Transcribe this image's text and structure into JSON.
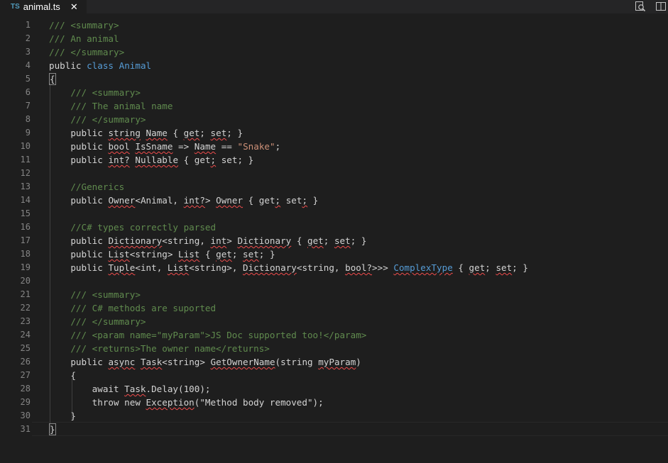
{
  "tab": {
    "lang_badge": "TS",
    "filename": "animal.ts",
    "close_glyph": "✕"
  },
  "toolbar": {
    "icons": [
      "open-changes-icon",
      "split-editor-icon"
    ]
  },
  "colors": {
    "background": "#1e1e1e",
    "comment": "#608b4e",
    "keyword": "#569cd6",
    "string": "#ce9178",
    "line_number": "#858585",
    "squiggle": "#f14c4c"
  },
  "lines": [
    {
      "n": "1",
      "tokens": [
        {
          "t": "/// <summary>",
          "c": "comment"
        }
      ]
    },
    {
      "n": "2",
      "tokens": [
        {
          "t": "/// An animal",
          "c": "comment"
        }
      ]
    },
    {
      "n": "3",
      "tokens": [
        {
          "t": "/// </summary>",
          "c": "comment"
        }
      ]
    },
    {
      "n": "4",
      "tokens": [
        {
          "t": "public",
          "c": "plain"
        },
        {
          "t": " "
        },
        {
          "t": "class",
          "c": "keyword"
        },
        {
          "t": " "
        },
        {
          "t": "Animal",
          "c": "keyword"
        }
      ]
    },
    {
      "n": "5",
      "tokens": [
        {
          "t": "{",
          "c": "bracket",
          "box": true
        }
      ]
    },
    {
      "n": "6",
      "tokens": [
        {
          "t": "    "
        },
        {
          "t": "/// <summary>",
          "c": "comment"
        }
      ]
    },
    {
      "n": "7",
      "tokens": [
        {
          "t": "    "
        },
        {
          "t": "/// The animal name",
          "c": "comment"
        }
      ]
    },
    {
      "n": "8",
      "tokens": [
        {
          "t": "    "
        },
        {
          "t": "/// </summary>",
          "c": "comment"
        }
      ]
    },
    {
      "n": "9",
      "tokens": [
        {
          "t": "    "
        },
        {
          "t": "public",
          "c": "plain"
        },
        {
          "t": " "
        },
        {
          "t": "string",
          "c": "plain",
          "sq": true
        },
        {
          "t": " "
        },
        {
          "t": "Name",
          "c": "plain",
          "sq": true
        },
        {
          "t": " { "
        },
        {
          "t": "get",
          "c": "plain",
          "sq": true
        },
        {
          "t": "; "
        },
        {
          "t": "set",
          "c": "plain",
          "sq": true
        },
        {
          "t": "; }"
        }
      ]
    },
    {
      "n": "10",
      "tokens": [
        {
          "t": "    "
        },
        {
          "t": "public",
          "c": "plain"
        },
        {
          "t": " "
        },
        {
          "t": "bool",
          "c": "plain",
          "sq": true
        },
        {
          "t": " "
        },
        {
          "t": "IsSname",
          "c": "plain",
          "sq": true
        },
        {
          "t": " => "
        },
        {
          "t": "Name",
          "c": "plain",
          "sq": true
        },
        {
          "t": " == "
        },
        {
          "t": "\"Snake\"",
          "c": "string"
        },
        {
          "t": ";"
        }
      ]
    },
    {
      "n": "11",
      "tokens": [
        {
          "t": "    "
        },
        {
          "t": "public",
          "c": "plain"
        },
        {
          "t": " "
        },
        {
          "t": "int?",
          "c": "plain",
          "sq": true
        },
        {
          "t": " "
        },
        {
          "t": "Nullable",
          "c": "plain",
          "sq": true
        },
        {
          "t": " { get"
        },
        {
          "t": ";",
          "c": "plain",
          "sq": true
        },
        {
          "t": " set; }"
        }
      ]
    },
    {
      "n": "12",
      "tokens": []
    },
    {
      "n": "13",
      "tokens": [
        {
          "t": "    "
        },
        {
          "t": "//Generics",
          "c": "comment"
        }
      ]
    },
    {
      "n": "14",
      "tokens": [
        {
          "t": "    "
        },
        {
          "t": "public",
          "c": "plain"
        },
        {
          "t": " "
        },
        {
          "t": "Owner",
          "c": "plain",
          "sq": true
        },
        {
          "t": "<Animal, "
        },
        {
          "t": "int?",
          "c": "plain",
          "sq": true
        },
        {
          "t": "> "
        },
        {
          "t": "Owner",
          "c": "plain",
          "sq": true
        },
        {
          "t": " { get"
        },
        {
          "t": ";",
          "c": "plain",
          "sq": true
        },
        {
          "t": " set"
        },
        {
          "t": ";",
          "c": "plain",
          "sq": true
        },
        {
          "t": " }"
        }
      ]
    },
    {
      "n": "15",
      "tokens": []
    },
    {
      "n": "16",
      "tokens": [
        {
          "t": "    "
        },
        {
          "t": "//C# types correctly parsed",
          "c": "comment"
        }
      ]
    },
    {
      "n": "17",
      "tokens": [
        {
          "t": "    "
        },
        {
          "t": "public",
          "c": "plain"
        },
        {
          "t": " "
        },
        {
          "t": "Dictionary",
          "c": "plain",
          "sq": true
        },
        {
          "t": "<string, "
        },
        {
          "t": "int",
          "c": "plain",
          "sq": true
        },
        {
          "t": "> "
        },
        {
          "t": "Dictionary",
          "c": "plain",
          "sq": true
        },
        {
          "t": " { "
        },
        {
          "t": "get",
          "c": "plain",
          "sq": true
        },
        {
          "t": "; "
        },
        {
          "t": "set",
          "c": "plain",
          "sq": true
        },
        {
          "t": "; }"
        }
      ]
    },
    {
      "n": "18",
      "tokens": [
        {
          "t": "    "
        },
        {
          "t": "public",
          "c": "plain"
        },
        {
          "t": " "
        },
        {
          "t": "List",
          "c": "plain",
          "sq": true
        },
        {
          "t": "<string> "
        },
        {
          "t": "List",
          "c": "plain",
          "sq": true
        },
        {
          "t": " { "
        },
        {
          "t": "get",
          "c": "plain",
          "sq": true
        },
        {
          "t": "; "
        },
        {
          "t": "set",
          "c": "plain",
          "sq": true
        },
        {
          "t": "; }"
        }
      ]
    },
    {
      "n": "19",
      "tokens": [
        {
          "t": "    "
        },
        {
          "t": "public",
          "c": "plain"
        },
        {
          "t": " "
        },
        {
          "t": "Tuple",
          "c": "plain",
          "sq": true
        },
        {
          "t": "<int, "
        },
        {
          "t": "List",
          "c": "plain",
          "sq": true
        },
        {
          "t": "<string>, "
        },
        {
          "t": "Dictionary",
          "c": "plain",
          "sq": true
        },
        {
          "t": "<string, "
        },
        {
          "t": "bool?",
          "c": "plain",
          "sq": true
        },
        {
          "t": ">>> "
        },
        {
          "t": "ComplexType",
          "c": "keyword",
          "sq": true
        },
        {
          "t": " { "
        },
        {
          "t": "get",
          "c": "plain",
          "sq": true
        },
        {
          "t": "; "
        },
        {
          "t": "set",
          "c": "plain",
          "sq": true
        },
        {
          "t": "; }"
        }
      ]
    },
    {
      "n": "20",
      "tokens": []
    },
    {
      "n": "21",
      "tokens": [
        {
          "t": "    "
        },
        {
          "t": "/// <summary>",
          "c": "comment"
        }
      ]
    },
    {
      "n": "22",
      "tokens": [
        {
          "t": "    "
        },
        {
          "t": "/// C# methods are suported",
          "c": "comment"
        }
      ]
    },
    {
      "n": "23",
      "tokens": [
        {
          "t": "    "
        },
        {
          "t": "/// </summary>",
          "c": "comment"
        }
      ]
    },
    {
      "n": "24",
      "tokens": [
        {
          "t": "    "
        },
        {
          "t": "/// <param name=\"myParam\">JS Doc supported too!</param>",
          "c": "comment"
        }
      ]
    },
    {
      "n": "25",
      "tokens": [
        {
          "t": "    "
        },
        {
          "t": "/// <returns>The owner name</returns>",
          "c": "comment"
        }
      ]
    },
    {
      "n": "26",
      "tokens": [
        {
          "t": "    "
        },
        {
          "t": "public",
          "c": "plain"
        },
        {
          "t": " "
        },
        {
          "t": "async",
          "c": "plain",
          "sq": true
        },
        {
          "t": " "
        },
        {
          "t": "Task",
          "c": "plain",
          "sq": true
        },
        {
          "t": "<string> "
        },
        {
          "t": "GetOwnerName",
          "c": "plain",
          "sq": true
        },
        {
          "t": "(string "
        },
        {
          "t": "myParam",
          "c": "plain",
          "sq": true
        },
        {
          "t": ")"
        }
      ]
    },
    {
      "n": "27",
      "tokens": [
        {
          "t": "    "
        },
        {
          "t": "{"
        }
      ]
    },
    {
      "n": "28",
      "tokens": [
        {
          "t": "        "
        },
        {
          "t": "await "
        },
        {
          "t": "Task",
          "c": "plain",
          "sq": true
        },
        {
          "t": ".Delay(100);"
        }
      ]
    },
    {
      "n": "29",
      "tokens": [
        {
          "t": "        "
        },
        {
          "t": "throw new "
        },
        {
          "t": "Exception",
          "c": "plain",
          "sq": true
        },
        {
          "t": "(\"Method body removed\");"
        }
      ]
    },
    {
      "n": "30",
      "tokens": [
        {
          "t": "    "
        },
        {
          "t": "}"
        }
      ]
    },
    {
      "n": "31",
      "tokens": [
        {
          "t": "}",
          "c": "bracket",
          "box": true
        }
      ]
    }
  ]
}
